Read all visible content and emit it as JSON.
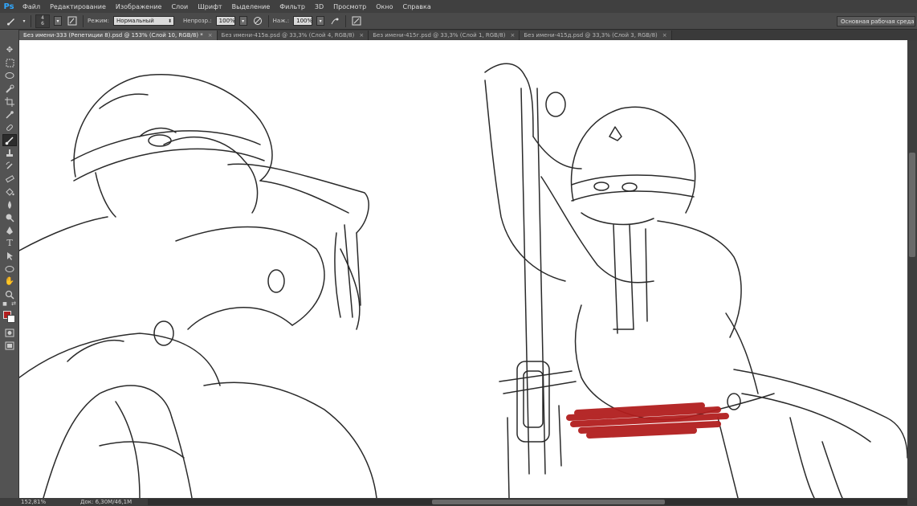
{
  "app": {
    "logo": "Ps"
  },
  "menu": [
    "Файл",
    "Редактирование",
    "Изображение",
    "Слои",
    "Шрифт",
    "Выделение",
    "Фильтр",
    "3D",
    "Просмотр",
    "Окно",
    "Справка"
  ],
  "options": {
    "brush_size_top": "4",
    "brush_size_bottom": "6",
    "mode_label": "Режим:",
    "mode_value": "Нормальный",
    "opacity_label": "Непрозр.:",
    "opacity_value": "100%",
    "pressure_label": "Наж.:",
    "pressure_value": "100%",
    "workspace": "Основная рабочая среда"
  },
  "tabs": [
    {
      "label": "Без имени-333 (Репетиции 8).psd @ 153% (Слой 10, RGB/8) *",
      "active": true
    },
    {
      "label": "Без имени-415в.psd @ 33,3% (Слой 4, RGB/8)",
      "active": false
    },
    {
      "label": "Без имени-415г.psd @ 33,3% (Слой 1, RGB/8)",
      "active": false
    },
    {
      "label": "Без имени-415д.psd @ 33,3% (Слой 3, RGB/8)",
      "active": false
    }
  ],
  "tools": [
    "move-icon",
    "marquee-icon",
    "lasso-icon",
    "quick-select-icon",
    "crop-icon",
    "eyedropper-icon",
    "healing-icon",
    "brush-icon",
    "stamp-icon",
    "history-brush-icon",
    "eraser-icon",
    "paint-bucket-icon",
    "blur-icon",
    "dodge-icon",
    "pen-icon",
    "type-icon",
    "path-select-icon",
    "shape-icon",
    "hand-icon",
    "zoom-icon"
  ],
  "colors": {
    "foreground": "#b21e1e",
    "background": "#ffffff",
    "accent": "#30a8ff"
  },
  "status": {
    "zoom": "152,81%",
    "doc": "Док: 6,30M/46,1M"
  }
}
